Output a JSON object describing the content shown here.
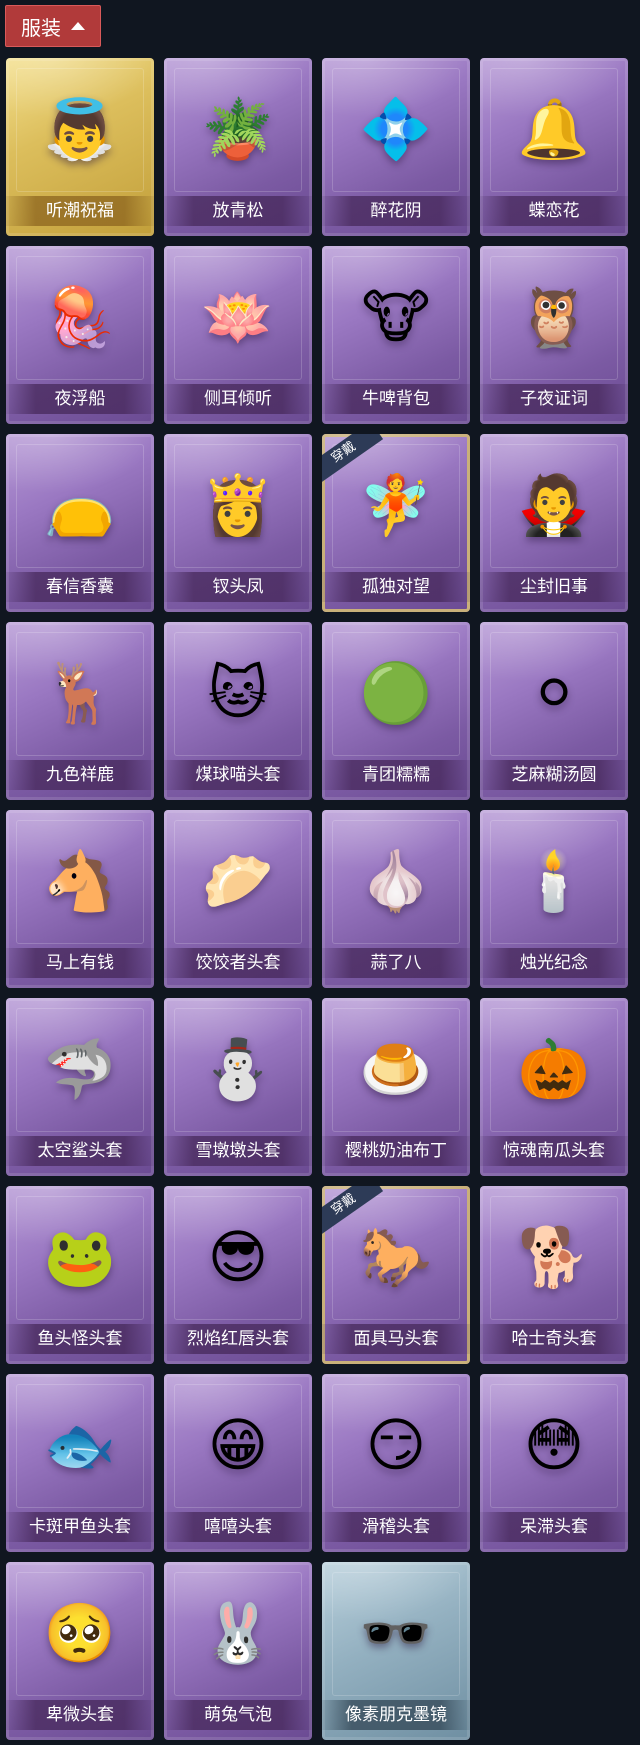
{
  "header": {
    "title": "服装",
    "icon": "chevron-up-icon"
  },
  "items": [
    {
      "label": "听潮祝福",
      "icon": "👼",
      "theme": "gold",
      "badge": ""
    },
    {
      "label": "放青松",
      "icon": "🪴",
      "theme": "purple",
      "badge": ""
    },
    {
      "label": "醉花阴",
      "icon": "💠",
      "theme": "purple",
      "badge": ""
    },
    {
      "label": "蝶恋花",
      "icon": "🔔",
      "theme": "purple",
      "badge": ""
    },
    {
      "label": "夜浮船",
      "icon": "🪼",
      "theme": "purple",
      "badge": ""
    },
    {
      "label": "侧耳倾听",
      "icon": "🪷",
      "theme": "purple",
      "badge": ""
    },
    {
      "label": "牛啤背包",
      "icon": "🐮",
      "theme": "purple",
      "badge": ""
    },
    {
      "label": "子夜证词",
      "icon": "🦉",
      "theme": "purple",
      "badge": ""
    },
    {
      "label": "春信香囊",
      "icon": "👝",
      "theme": "purple",
      "badge": ""
    },
    {
      "label": "钗头凤",
      "icon": "👸",
      "theme": "purple",
      "badge": ""
    },
    {
      "label": "孤独对望",
      "icon": "🧚",
      "theme": "purple",
      "badge": "穿戴"
    },
    {
      "label": "尘封旧事",
      "icon": "🧛",
      "theme": "purple",
      "badge": ""
    },
    {
      "label": "九色祥鹿",
      "icon": "🦌",
      "theme": "purple",
      "badge": ""
    },
    {
      "label": "煤球喵头套",
      "icon": "🐱",
      "theme": "purple",
      "badge": ""
    },
    {
      "label": "青团糯糯",
      "icon": "🟢",
      "theme": "purple",
      "badge": ""
    },
    {
      "label": "芝麻糊汤圆",
      "icon": "⚪",
      "theme": "purple",
      "badge": ""
    },
    {
      "label": "马上有钱",
      "icon": "🐴",
      "theme": "purple",
      "badge": ""
    },
    {
      "label": "饺饺者头套",
      "icon": "🥟",
      "theme": "purple",
      "badge": ""
    },
    {
      "label": "蒜了八",
      "icon": "🧄",
      "theme": "purple",
      "badge": ""
    },
    {
      "label": "烛光纪念",
      "icon": "🕯️",
      "theme": "purple",
      "badge": ""
    },
    {
      "label": "太空鲨头套",
      "icon": "🦈",
      "theme": "purple",
      "badge": ""
    },
    {
      "label": "雪墩墩头套",
      "icon": "⛄",
      "theme": "purple",
      "badge": ""
    },
    {
      "label": "樱桃奶油布丁",
      "icon": "🍮",
      "theme": "purple",
      "badge": ""
    },
    {
      "label": "惊魂南瓜头套",
      "icon": "🎃",
      "theme": "purple",
      "badge": ""
    },
    {
      "label": "鱼头怪头套",
      "icon": "🐸",
      "theme": "purple",
      "badge": ""
    },
    {
      "label": "烈焰红唇头套",
      "icon": "😎",
      "theme": "purple",
      "badge": ""
    },
    {
      "label": "面具马头套",
      "icon": "🐎",
      "theme": "purple",
      "badge": "穿戴"
    },
    {
      "label": "哈士奇头套",
      "icon": "🐕",
      "theme": "purple",
      "badge": ""
    },
    {
      "label": "卡斑甲鱼头套",
      "icon": "🐟",
      "theme": "purple",
      "badge": ""
    },
    {
      "label": "嘻嘻头套",
      "icon": "😁",
      "theme": "purple",
      "badge": ""
    },
    {
      "label": "滑稽头套",
      "icon": "😏",
      "theme": "purple",
      "badge": ""
    },
    {
      "label": "呆滞头套",
      "icon": "😳",
      "theme": "purple",
      "badge": ""
    },
    {
      "label": "卑微头套",
      "icon": "🥺",
      "theme": "purple",
      "badge": ""
    },
    {
      "label": "萌兔气泡",
      "icon": "🐰",
      "theme": "purple",
      "badge": ""
    },
    {
      "label": "像素朋克墨镜",
      "icon": "🕶️",
      "theme": "blue",
      "badge": ""
    }
  ]
}
